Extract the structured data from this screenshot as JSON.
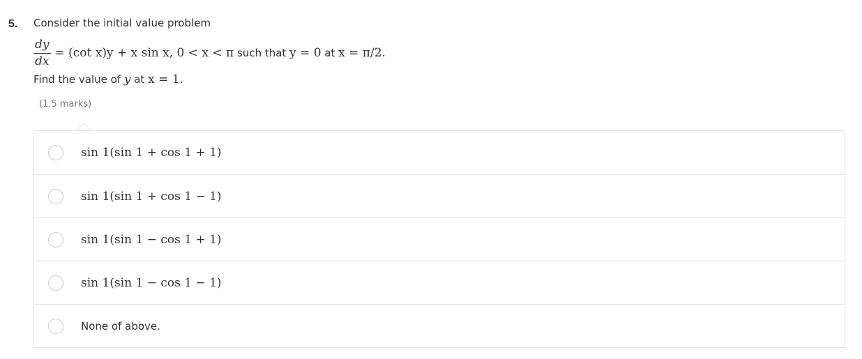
{
  "question": {
    "number": "5.",
    "intro": "Consider the initial value problem",
    "equation": {
      "frac_num": "dy",
      "frac_den": "dx",
      "rhs": "= (cot x)y + x sin x,  0 < x < π",
      "cond_text": " such that ",
      "cond_y": "y = 0",
      "cond_at": " at ",
      "cond_x": "x = π/2."
    },
    "find": {
      "text_before": "Find the value of ",
      "var_y": "y",
      "text_at": " at ",
      "cond": "x = 1."
    },
    "marks": "(1.5 marks)"
  },
  "options": [
    {
      "label": "sin 1(sin 1 + cos 1 + 1)",
      "plain": false
    },
    {
      "label": "sin 1(sin 1 + cos 1 − 1)",
      "plain": false
    },
    {
      "label": "sin 1(sin 1 − cos 1 + 1)",
      "plain": false
    },
    {
      "label": "sin 1(sin 1 − cos 1 − 1)",
      "plain": false
    },
    {
      "label": "None of above.",
      "plain": true
    }
  ],
  "colors": {
    "text": "#333333",
    "muted": "#777777",
    "border": "#e3e3e3",
    "radio_border": "#c9c9c9"
  }
}
